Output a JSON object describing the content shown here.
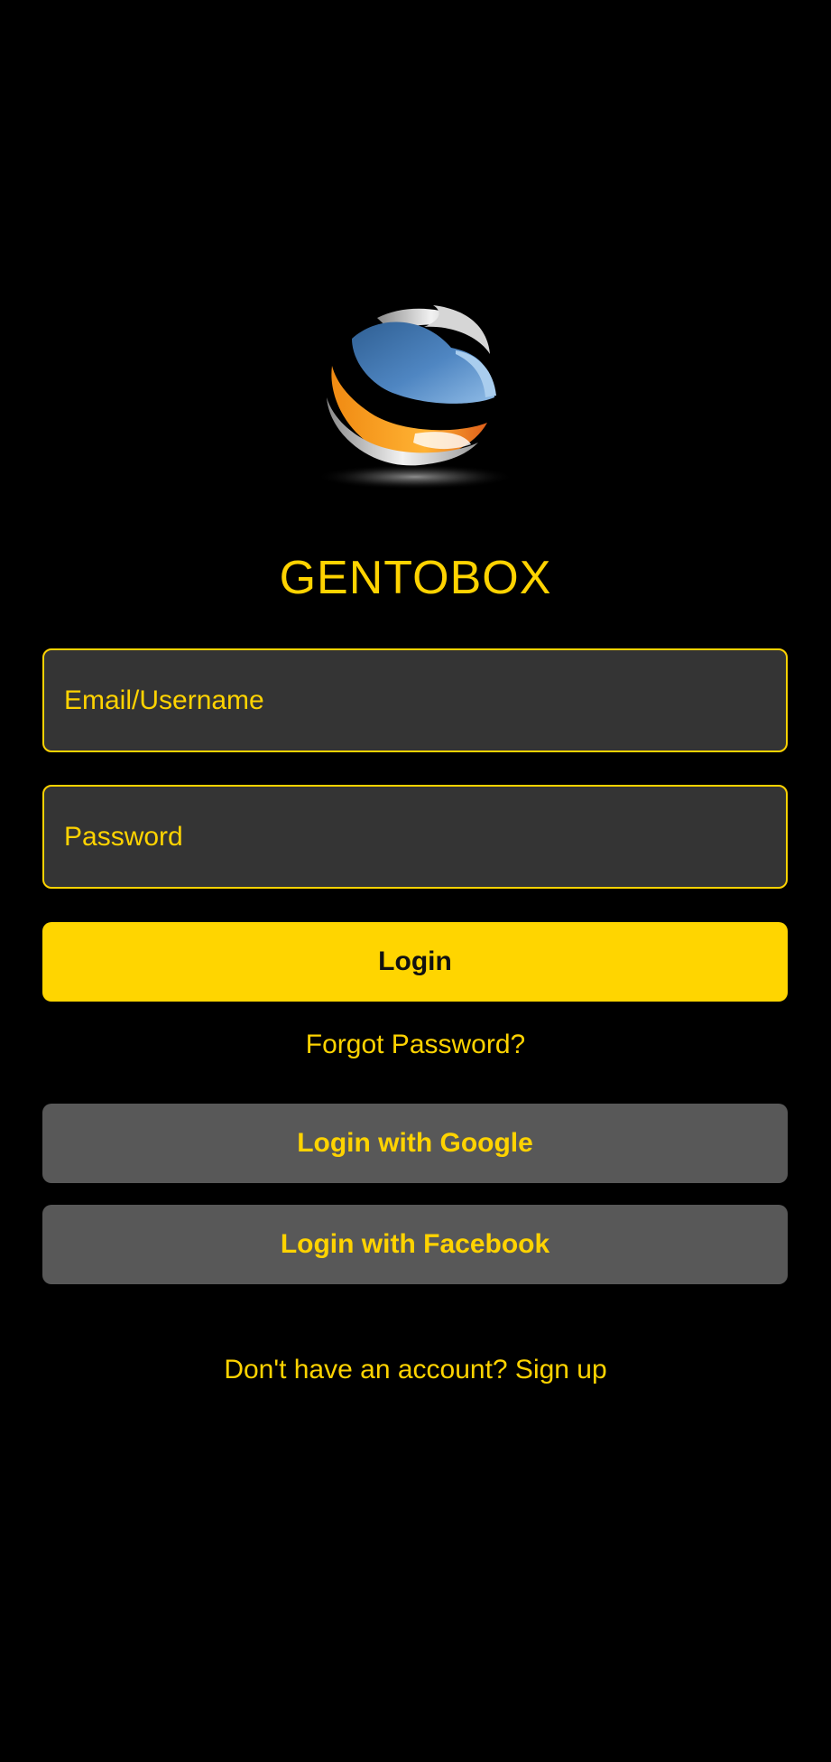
{
  "brand": {
    "app_name": "GENTOBOX",
    "logo_icon": "globe-ribbon-logo-icon",
    "colors": {
      "accent": "#FFD300",
      "background": "#000000",
      "field_bg": "#343434",
      "social_button_bg": "#585858",
      "login_button_bg": "#FFD500"
    }
  },
  "form": {
    "email_placeholder": "Email/Username",
    "email_value": "",
    "password_placeholder": "Password",
    "password_value": "",
    "login_label": "Login",
    "forgot_label": "Forgot Password?"
  },
  "social": {
    "google_label": "Login with Google",
    "facebook_label": "Login with Facebook"
  },
  "footer": {
    "signup_prompt": "Don't have an account? Sign up"
  }
}
